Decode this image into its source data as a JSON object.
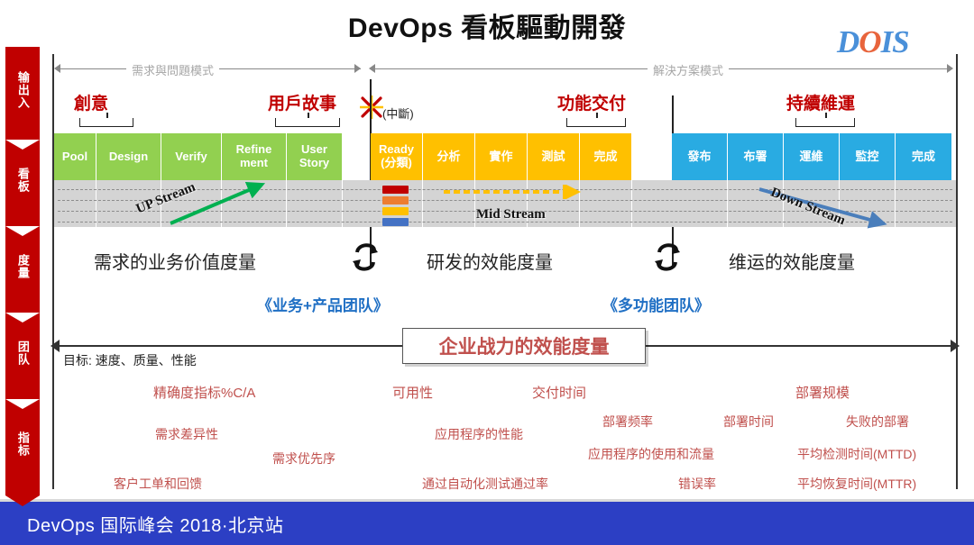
{
  "title": "DevOps 看板驅動開發",
  "logo": {
    "part1": "D",
    "part2": "O",
    "part3": "IS"
  },
  "rail": {
    "items": [
      {
        "label": "输出入"
      },
      {
        "label": "看板"
      },
      {
        "label": "度量"
      },
      {
        "label": "团队"
      },
      {
        "label": "指标"
      }
    ]
  },
  "modes": [
    {
      "label": "需求與問題模式"
    },
    {
      "label": "解決方案模式"
    }
  ],
  "phases": [
    {
      "label": "創意"
    },
    {
      "label": "用戶故事"
    },
    {
      "label": "功能交付"
    },
    {
      "label": "持續維運"
    }
  ],
  "interrupt": {
    "label": "(中斷)",
    "icon": "burst-icon"
  },
  "columns": [
    {
      "label": "Pool",
      "color": "green"
    },
    {
      "label": "Design",
      "color": "green"
    },
    {
      "label": "Verify",
      "color": "green"
    },
    {
      "label": "Refine\nment",
      "color": "green"
    },
    {
      "label": "User\nStory",
      "color": "green"
    },
    {
      "label": "Ready\n(分類)",
      "color": "amber"
    },
    {
      "label": "分析",
      "color": "amber"
    },
    {
      "label": "實作",
      "color": "amber"
    },
    {
      "label": "測試",
      "color": "amber"
    },
    {
      "label": "完成",
      "color": "amber"
    },
    {
      "label": "發布",
      "color": "blue"
    },
    {
      "label": "布署",
      "color": "blue"
    },
    {
      "label": "運維",
      "color": "blue"
    },
    {
      "label": "監控",
      "color": "blue"
    },
    {
      "label": "完成",
      "color": "blue"
    }
  ],
  "streams": [
    {
      "label": "UP Stream",
      "arrow_color": "#00b050"
    },
    {
      "label": "Mid Stream",
      "arrow_color": "#ffc000"
    },
    {
      "label": "Down Stream",
      "arrow_color": "#4a7ebb"
    }
  ],
  "cards": [
    {
      "color": "#c00000"
    },
    {
      "color": "#ed7d31"
    },
    {
      "color": "#ffc000"
    },
    {
      "color": "#4472c4"
    }
  ],
  "measures": [
    {
      "label": "需求的业务价值度量"
    },
    {
      "label": "研发的效能度量"
    },
    {
      "label": "维运的效能度量"
    }
  ],
  "teams": [
    {
      "label": "《业务+产品团队》"
    },
    {
      "label": "《多功能团队》"
    }
  ],
  "center_box": {
    "label": "企业战力的效能度量"
  },
  "goal": {
    "label": "目标: 速度、质量、性能"
  },
  "kpis": [
    {
      "label": "精确度指标%C/A"
    },
    {
      "label": "可用性"
    },
    {
      "label": "交付时间"
    },
    {
      "label": "部署规模"
    },
    {
      "label": "需求差异性"
    },
    {
      "label": "应用程序的性能"
    },
    {
      "label": "部署频率"
    },
    {
      "label": "部署时间"
    },
    {
      "label": "失败的部署"
    },
    {
      "label": "需求优先序"
    },
    {
      "label": "应用程序的使用和流量"
    },
    {
      "label": "平均检测时间(MTTD)"
    },
    {
      "label": "客户工单和回馈"
    },
    {
      "label": "通过自动化测试通过率"
    },
    {
      "label": "错误率"
    },
    {
      "label": "平均恢复时间(MTTR)"
    }
  ],
  "banner": {
    "label": "DevOps 国际峰会 2018·北京站"
  },
  "colors": {
    "green": "#92d050",
    "amber": "#ffc000",
    "blue": "#29abe2",
    "red": "#c00000",
    "banner": "#2c3fc4",
    "lane": "#d4d4d4",
    "team_blue": "#1f6fc4",
    "kpi_red": "#c0504d"
  }
}
